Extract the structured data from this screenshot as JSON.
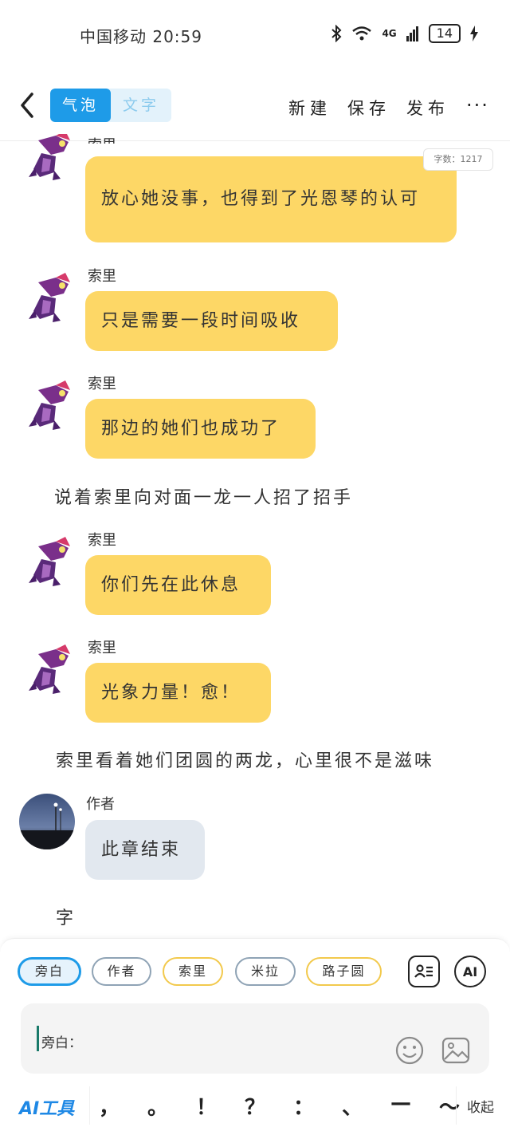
{
  "status": {
    "carrier": "中国移动",
    "time": "20:59",
    "network": "4G",
    "battery": "14"
  },
  "toolbar": {
    "tab_bubble": "气泡",
    "tab_text": "文字",
    "new_label": "新建",
    "save_label": "保存",
    "publish_label": "发布",
    "more_label": "···"
  },
  "word_count": "字数：1217",
  "messages": [
    {
      "name": "索里",
      "text": "放心她没事，也得到了光恩琴的认可"
    },
    {
      "name": "索里",
      "text": "只是需要一段时间吸收"
    },
    {
      "name": "索里",
      "text": "那边的她们也成功了"
    },
    {
      "narration": "说着索里向对面一龙一人招了招手"
    },
    {
      "name": "索里",
      "text": "你们先在此休息"
    },
    {
      "name": "索里",
      "text": "光象力量！愈！"
    },
    {
      "narration": "索里看着她们团圆的两龙，心里很不是滋味"
    },
    {
      "name": "作者",
      "text": "此章结束"
    },
    {
      "narration": "字"
    }
  ],
  "roles": [
    "旁白",
    "作者",
    "索里",
    "米拉",
    "路子圆"
  ],
  "ai_button": "AI",
  "input": {
    "label": "旁白："
  },
  "tools": {
    "ai_tool": "AI工具",
    "punctuation": [
      "，",
      "。",
      "！",
      "？",
      "：",
      "、",
      "—",
      "～"
    ],
    "collapse": "收起"
  },
  "colors": {
    "accent": "#1e9be8",
    "bubble": "#fdd766",
    "author_bubble": "#e2e8ef"
  }
}
